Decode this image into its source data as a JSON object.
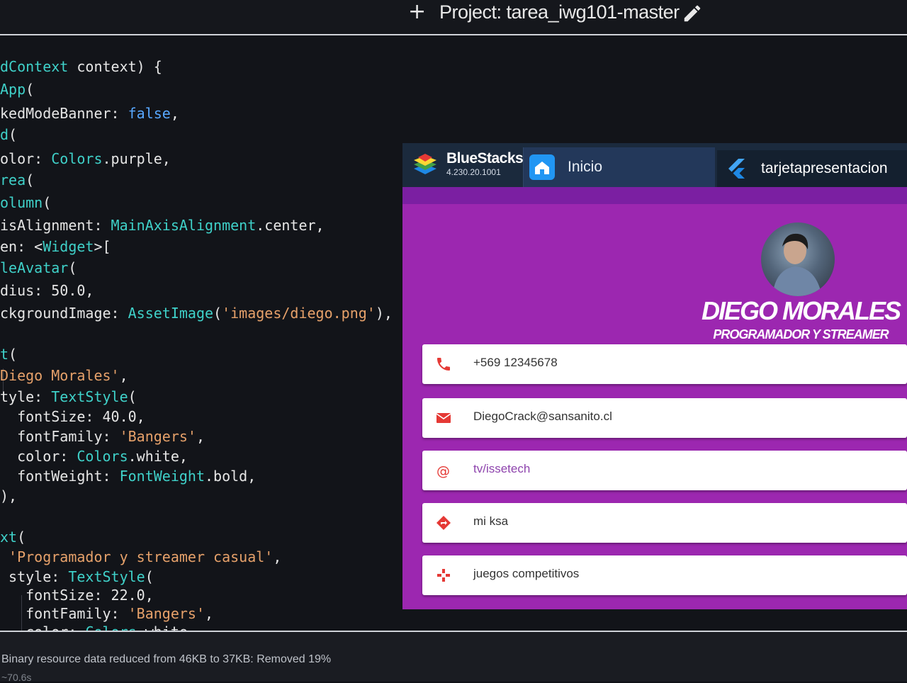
{
  "ide": {
    "project_title": "Project: tarea_iwg101-master",
    "status_message": "Binary resource data reduced from 46KB to 37KB: Removed 19%",
    "status_sub": "~70.6s"
  },
  "code_lines": [
    [
      [
        "dContext",
        "type"
      ],
      [
        " context) {",
        "plain"
      ]
    ],
    [
      [
        "App",
        "type"
      ],
      [
        "(",
        "plain"
      ]
    ],
    [
      [
        "kedModeBanner: ",
        "plain"
      ],
      [
        "false",
        "bool"
      ],
      [
        ",",
        "plain"
      ]
    ],
    [
      [
        "d",
        "type"
      ],
      [
        "(",
        "plain"
      ]
    ],
    [
      [
        "olor: ",
        "plain"
      ],
      [
        "Colors",
        "type"
      ],
      [
        ".purple,",
        "plain"
      ]
    ],
    [
      [
        "rea",
        "type"
      ],
      [
        "(",
        "plain"
      ]
    ],
    [
      [
        "olumn",
        "type"
      ],
      [
        "(",
        "plain"
      ]
    ],
    [
      [
        "isAlignment: ",
        "plain"
      ],
      [
        "MainAxisAlignment",
        "type"
      ],
      [
        ".center,",
        "plain"
      ]
    ],
    [
      [
        "en: <",
        "plain"
      ],
      [
        "Widget",
        "type"
      ],
      [
        ">[",
        "plain"
      ]
    ],
    [
      [
        "leAvatar",
        "type"
      ],
      [
        "(",
        "plain"
      ]
    ],
    [
      [
        "dius: 50.0,",
        "plain"
      ]
    ],
    [
      [
        "ckgroundImage: ",
        "plain"
      ],
      [
        "AssetImage",
        "type"
      ],
      [
        "(",
        "plain"
      ],
      [
        "'images/diego.png'",
        "str"
      ],
      [
        "),",
        "plain"
      ]
    ],
    [
      [
        "",
        "plain"
      ]
    ],
    [
      [
        "t",
        "type"
      ],
      [
        "(",
        "plain"
      ]
    ],
    [
      [
        "Diego Morales'",
        "str"
      ],
      [
        ",",
        "plain"
      ]
    ],
    [
      [
        "tyle: ",
        "plain"
      ],
      [
        "TextStyle",
        "type"
      ],
      [
        "(",
        "plain"
      ]
    ],
    [
      [
        "  fontSize: 40.0,",
        "plain"
      ]
    ],
    [
      [
        "  fontFamily: ",
        "plain"
      ],
      [
        "'Bangers'",
        "str"
      ],
      [
        ",",
        "plain"
      ]
    ],
    [
      [
        "  color: ",
        "plain"
      ],
      [
        "Colors",
        "type"
      ],
      [
        ".white,",
        "plain"
      ]
    ],
    [
      [
        "  fontWeight: ",
        "plain"
      ],
      [
        "FontWeight",
        "type"
      ],
      [
        ".bold,",
        "plain"
      ]
    ],
    [
      [
        "),",
        "plain"
      ]
    ],
    [
      [
        "",
        "plain"
      ]
    ],
    [
      [
        "xt",
        "type"
      ],
      [
        "(",
        "plain"
      ]
    ],
    [
      [
        " ",
        "plain"
      ],
      [
        "'Programador y streamer casual'",
        "str"
      ],
      [
        ",",
        "plain"
      ]
    ],
    [
      [
        " style: ",
        "plain"
      ],
      [
        "TextStyle",
        "type"
      ],
      [
        "(",
        "plain"
      ]
    ],
    [
      [
        "   fontSize: 22.0,",
        "plain"
      ]
    ],
    [
      [
        "   fontFamily: ",
        "plain"
      ],
      [
        "'Bangers'",
        "str"
      ],
      [
        ",",
        "plain"
      ]
    ],
    [
      [
        "   color: ",
        "plain"
      ],
      [
        "Colors",
        "type"
      ],
      [
        ".white",
        "plain"
      ]
    ]
  ],
  "emulator": {
    "brand": "BlueStacks",
    "version": "4.230.20.1001",
    "home_tab": "Inicio",
    "app_tab": "tarjetapresentacion"
  },
  "app": {
    "background": "#9c27b0",
    "name": "DIEGO MORALES",
    "role": "PROGRAMADOR Y STREAMER CASUAL",
    "cards": [
      {
        "icon": "phone-icon",
        "text": "+569 12345678",
        "color": "#e53935"
      },
      {
        "icon": "mail-icon",
        "text": "DiegoCrack@sansanito.cl",
        "color": "#e53935"
      },
      {
        "icon": "at-icon",
        "text": "tv/issetech",
        "color": "#e53935"
      },
      {
        "icon": "directions-icon",
        "text": "mi ksa",
        "color": "#e53935"
      },
      {
        "icon": "gamepad-icon",
        "text": "juegos competitivos",
        "color": "#e53935"
      }
    ]
  }
}
